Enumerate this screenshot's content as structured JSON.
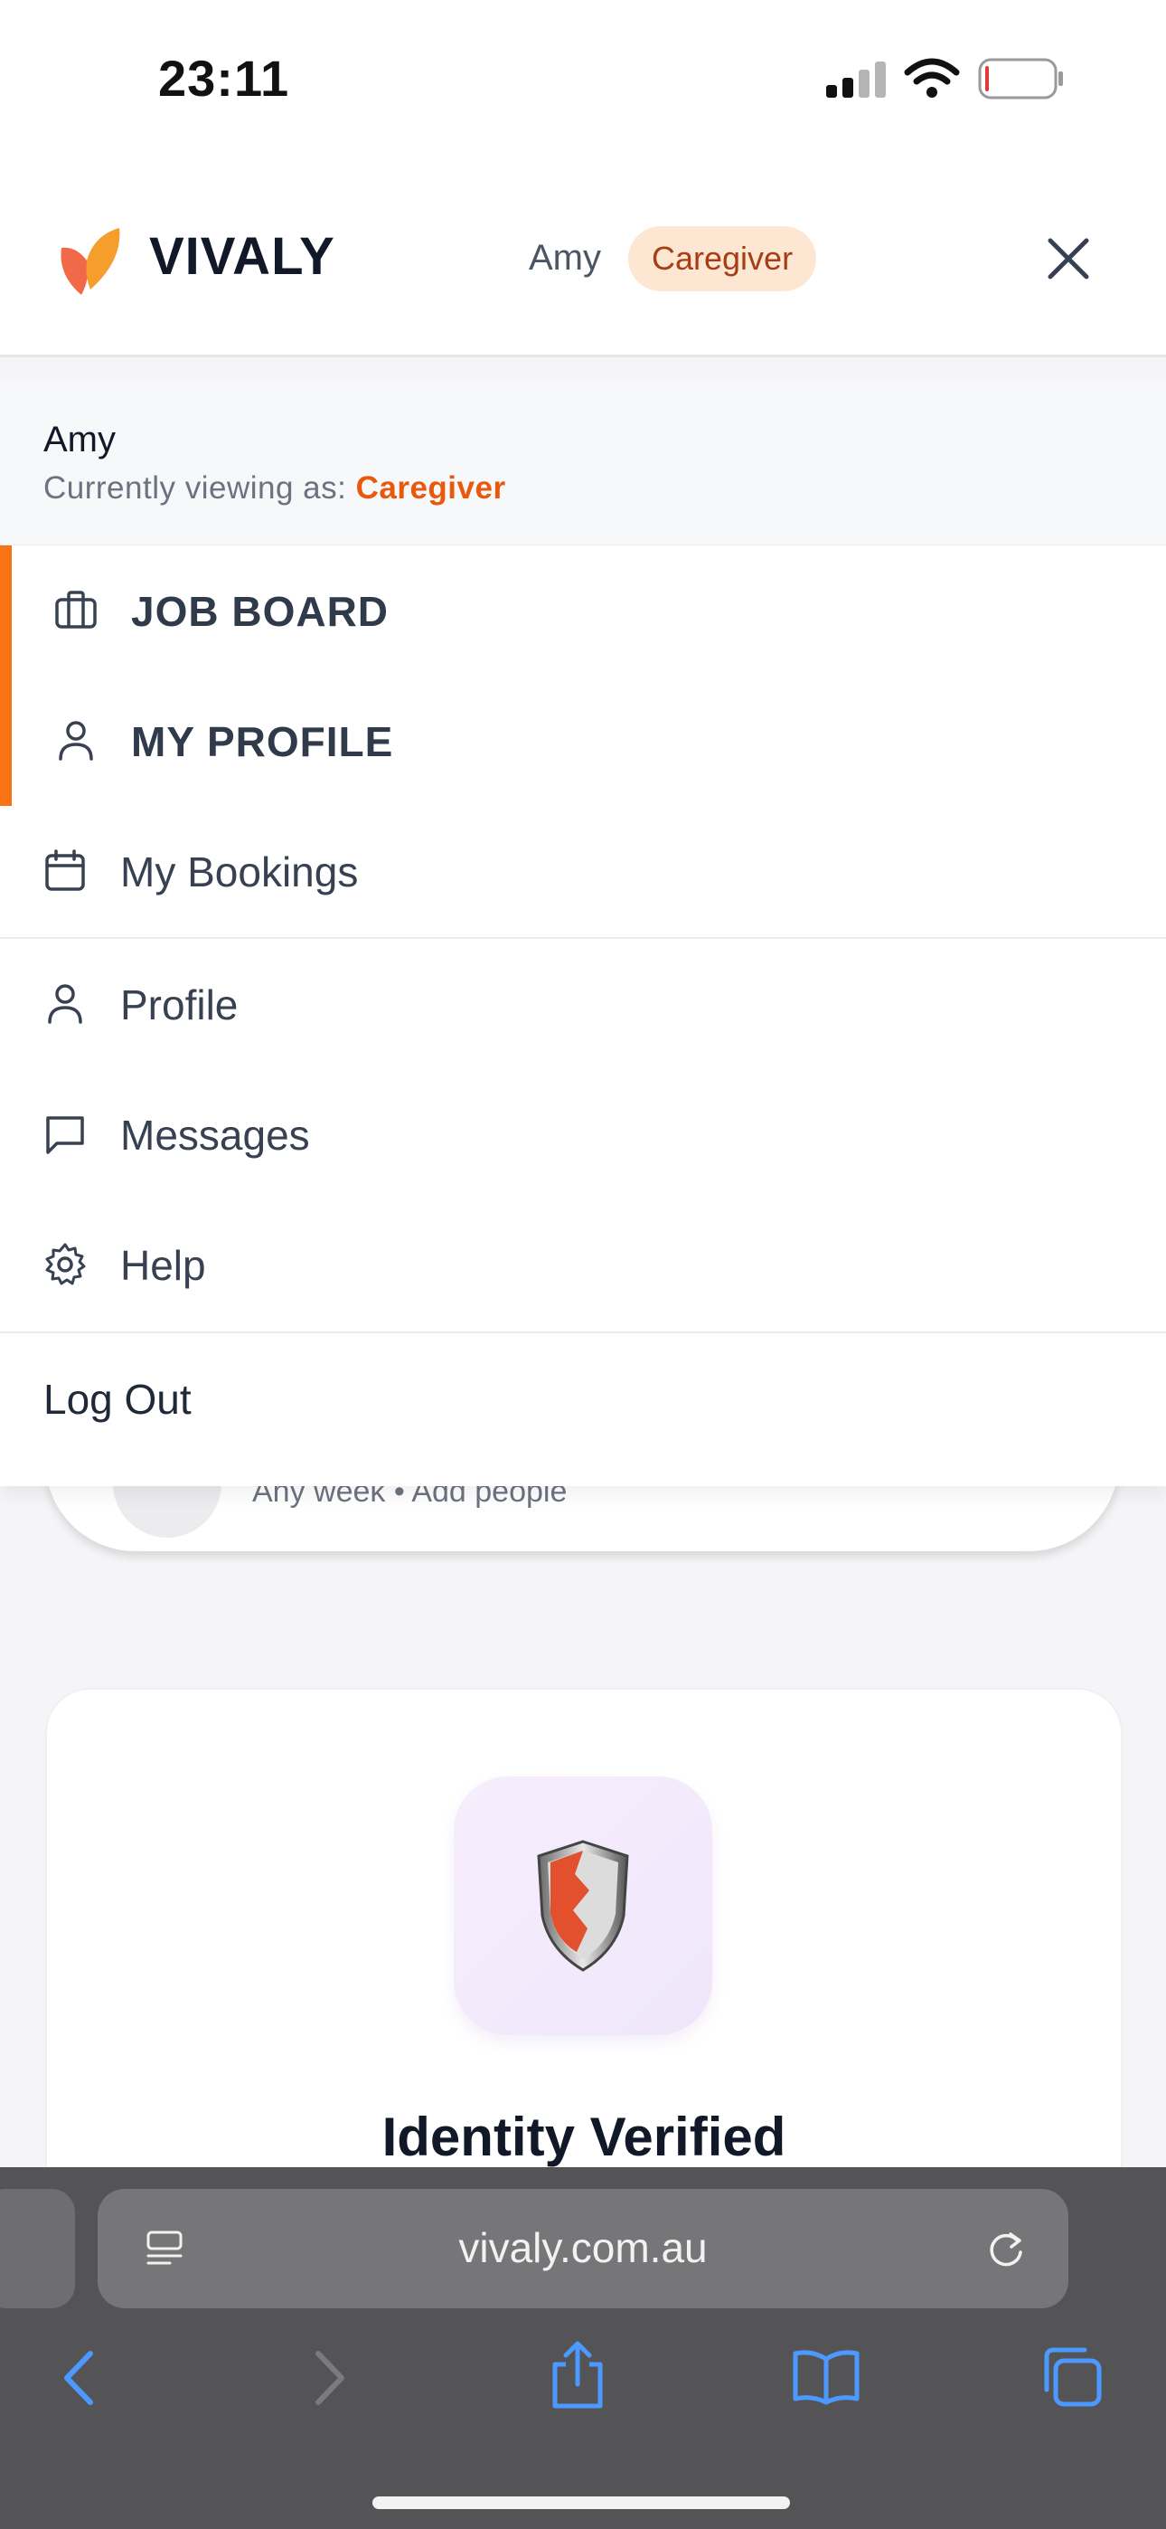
{
  "status_bar": {
    "time": "23:11"
  },
  "header": {
    "brand": "VIVALY",
    "user_name": "Amy",
    "role_badge": "Caregiver"
  },
  "user_panel": {
    "name": "Amy",
    "viewing_prefix": "Currently viewing as: ",
    "viewing_role": "Caregiver"
  },
  "menu": {
    "job_board": "JOB BOARD",
    "my_profile": "MY PROFILE",
    "my_bookings": "My Bookings",
    "profile": "Profile",
    "messages": "Messages",
    "help": "Help",
    "log_out": "Log Out"
  },
  "background": {
    "search_subtitle": "Any week • Add people",
    "verified_title": "Identity Verified"
  },
  "browser": {
    "url": "vivaly.com.au"
  },
  "colors": {
    "accent": "#f97316",
    "role_text": "#ea580c",
    "badge_bg": "#fde7d3",
    "browser_icons": "#3b82f6"
  }
}
